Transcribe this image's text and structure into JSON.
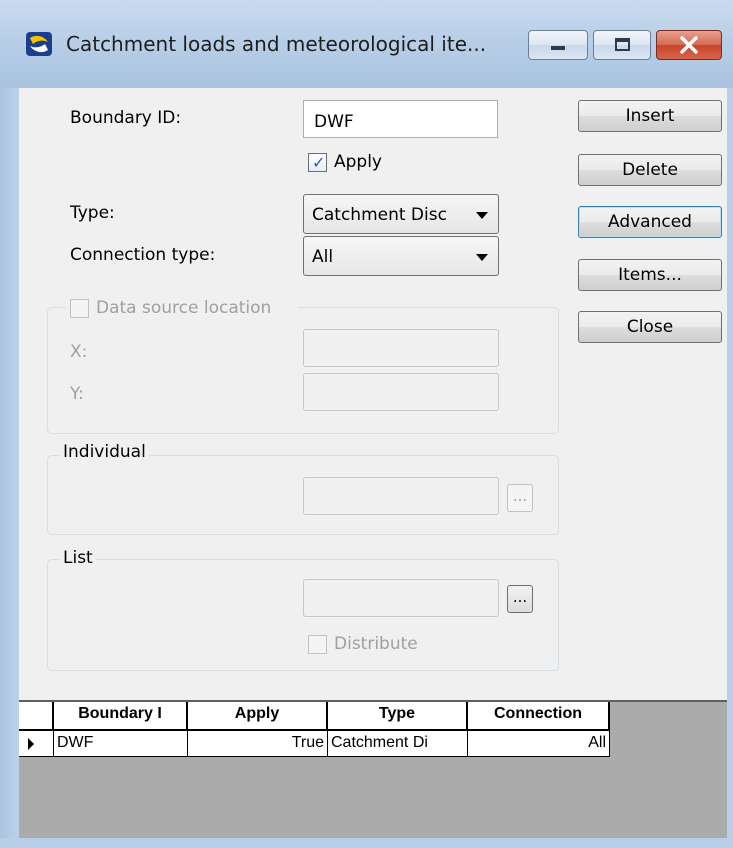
{
  "window": {
    "title": "Catchment loads and meteorological ite...",
    "icon": "app-icon",
    "controls": [
      "minimize-icon",
      "maximize-icon",
      "close-icon"
    ]
  },
  "form": {
    "boundary_id_label": "Boundary ID:",
    "boundary_id_value": "DWF",
    "apply_label": "Apply",
    "apply_checked": true,
    "type_label": "Type:",
    "type_value": "Catchment Disc",
    "connection_type_label": "Connection type:",
    "connection_type_value": "All",
    "data_source": {
      "title": "Data source location",
      "checked": false,
      "x_label": "X:",
      "y_label": "Y:",
      "x_value": "",
      "y_value": ""
    },
    "individual": {
      "title": "Individual",
      "value": "",
      "browse_label": "..."
    },
    "list": {
      "title": "List",
      "value": "",
      "browse_label": "...",
      "distribute_label": "Distribute",
      "distribute_checked": false
    }
  },
  "buttons": {
    "insert": "Insert",
    "delete": "Delete",
    "advanced": "Advanced",
    "items": "Items...",
    "close": "Close"
  },
  "grid": {
    "columns": [
      "Boundary I",
      "Apply",
      "Type",
      "Connection"
    ],
    "rows": [
      {
        "boundary_id": "DWF",
        "apply": "True",
        "type": "Catchment Di",
        "connection": "All",
        "current": true
      }
    ]
  },
  "colors": {
    "titlebar": "#b9cfe8",
    "client_bg": "#f0f0f0",
    "check_tick": "#2a56c6",
    "close_button": "#c8442a",
    "grid_bg": "#ababab"
  }
}
